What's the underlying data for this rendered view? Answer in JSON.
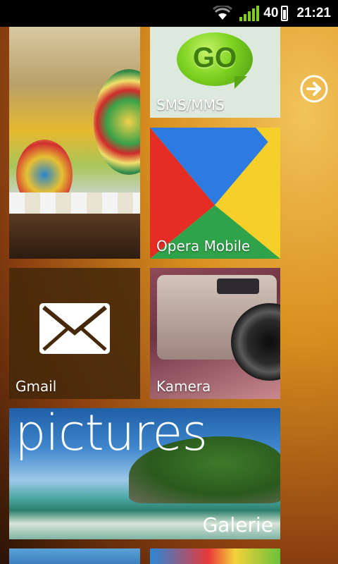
{
  "status_bar": {
    "signal_percent": "40",
    "time": "21:21",
    "icons": [
      "wifi-icon",
      "signal-icon",
      "battery-icon"
    ]
  },
  "tiles": {
    "photo": {
      "icon": "festival-photo"
    },
    "sms": {
      "label": "SMS/MMS",
      "logo_text": "GO"
    },
    "opera": {
      "label": "Opera Mobile"
    },
    "gmail": {
      "label": "Gmail",
      "icon": "mail-icon"
    },
    "camera": {
      "label": "Kamera"
    },
    "gallery": {
      "title": "pictures",
      "label": "Galerie"
    }
  },
  "navigation": {
    "next_icon": "arrow-right-circle-icon"
  },
  "colors": {
    "accent_green": "#7ed321",
    "gmail_tile": "#46280a",
    "statusbar": "#000000"
  }
}
